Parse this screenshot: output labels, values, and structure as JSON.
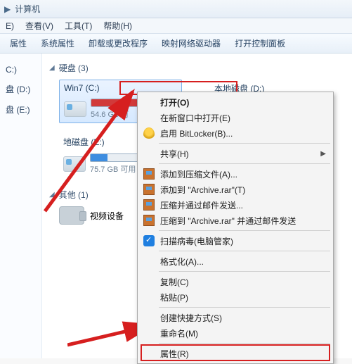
{
  "titlebar": {
    "location": "计算机"
  },
  "menubar": {
    "edit": "E)",
    "view": "查看(V)",
    "tools": "工具(T)",
    "help": "帮助(H)"
  },
  "toolbar": {
    "props": "属性",
    "sysprops": "系统属性",
    "uninstall": "卸载或更改程序",
    "mapnet": "映射网络驱动器",
    "ctrlpanel": "打开控制面板"
  },
  "sidebar": {
    "item1": "C:)",
    "item2": "盘 (D:)",
    "item3": "盘 (E:)"
  },
  "sections": {
    "hdd": "硬盘 (3)",
    "other": "其他 (1)"
  },
  "drives": {
    "c": {
      "label": "Win7 (C:)",
      "cap": "54.6 GB 可",
      "fillpct": 88
    },
    "d": {
      "label": "本地磁盘 (D:)"
    },
    "e": {
      "label": "地磁盘 (E:)",
      "cap": "75.7 GB 可用",
      "fillpct": 22
    }
  },
  "other": {
    "video": "视频设备"
  },
  "menu": {
    "open": "打开(O)",
    "opennew": "在新窗口中打开(E)",
    "bitlocker": "启用 BitLocker(B)...",
    "share": "共享(H)",
    "addarchive": "添加到压缩文件(A)...",
    "addrar": "添加到 \"Archive.rar\"(T)",
    "compressmail": "压缩并通过邮件发送...",
    "compressrar": "压缩到 \"Archive.rar\" 并通过邮件发送",
    "scan": "扫描病毒(电脑管家)",
    "format": "格式化(A)...",
    "copy": "复制(C)",
    "paste": "粘贴(P)",
    "shortcut": "创建快捷方式(S)",
    "rename": "重命名(M)",
    "props": "属性(R)"
  }
}
